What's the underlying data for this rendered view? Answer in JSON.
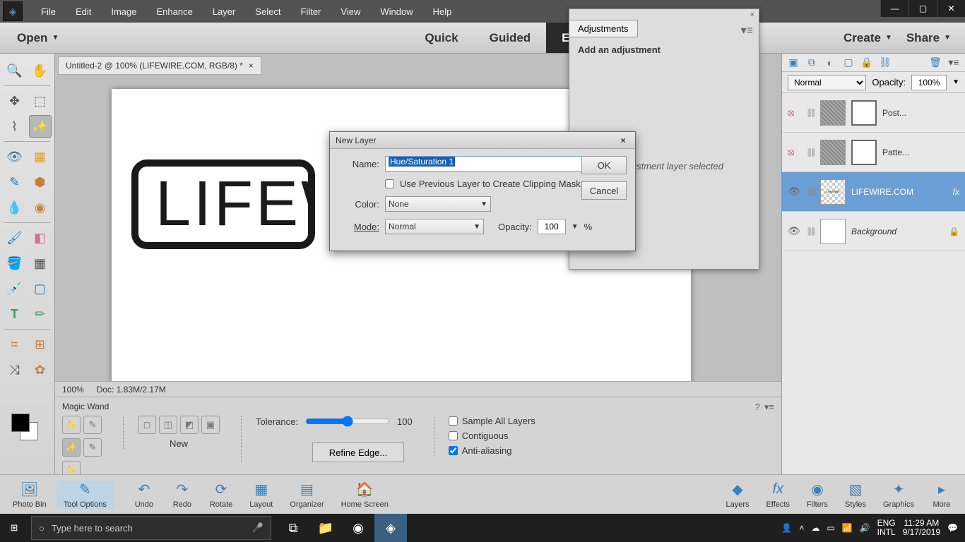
{
  "menubar": {
    "items": [
      "File",
      "Edit",
      "Image",
      "Enhance",
      "Layer",
      "Select",
      "Filter",
      "View",
      "Window",
      "Help"
    ]
  },
  "modebar": {
    "open": "Open",
    "tabs": [
      "Quick",
      "Guided",
      "Expert"
    ],
    "active": "Expert",
    "create": "Create",
    "share": "Share"
  },
  "doc_tab": "Untitled-2 @ 100% (LIFEWIRE.COM, RGB/8) *",
  "stamp_text": "LIFEWIRE.COM",
  "status": {
    "zoom": "100%",
    "doc": "Doc: 1.83M/2.17M"
  },
  "options": {
    "title": "Magic Wand",
    "mode_label": "New",
    "tolerance_label": "Tolerance:",
    "tolerance_value": "100",
    "refine": "Refine Edge...",
    "checks": [
      "Sample All Layers",
      "Contiguous",
      "Anti-aliasing"
    ],
    "checked": [
      false,
      false,
      true
    ]
  },
  "adjustments": {
    "tab": "Adjustments",
    "heading": "Add an adjustment",
    "hint": "No adjustment layer selected"
  },
  "dialog": {
    "title": "New Layer",
    "name_label": "Name:",
    "name_value": "Hue/Saturation 1",
    "clip": "Use Previous Layer to Create Clipping Mask",
    "color_label": "Color:",
    "color_value": "None",
    "mode_label": "Mode:",
    "mode_value": "Normal",
    "opacity_label": "Opacity:",
    "opacity_value": "100",
    "opacity_unit": "%",
    "ok": "OK",
    "cancel": "Cancel"
  },
  "layers_panel": {
    "blend": "Normal",
    "opacity_label": "Opacity:",
    "opacity": "100%",
    "rows": [
      {
        "name": "Post...",
        "visible": false,
        "type": "pattern",
        "mask": true
      },
      {
        "name": "Patte...",
        "visible": false,
        "type": "pattern",
        "mask": true
      },
      {
        "name": "LIFEWIRE.COM",
        "visible": true,
        "type": "checker",
        "selected": true,
        "fx": true
      },
      {
        "name": "Background",
        "visible": true,
        "type": "white",
        "locked": true
      }
    ]
  },
  "footer": {
    "left": [
      "Photo Bin",
      "Tool Options",
      "Undo",
      "Redo",
      "Rotate",
      "Layout",
      "Organizer",
      "Home Screen"
    ],
    "right": [
      "Layers",
      "Effects",
      "Filters",
      "Styles",
      "Graphics",
      "More"
    ]
  },
  "taskbar": {
    "search_placeholder": "Type here to search",
    "lang": "ENG",
    "kbd": "INTL",
    "time": "11:29 AM",
    "date": "9/17/2019"
  }
}
